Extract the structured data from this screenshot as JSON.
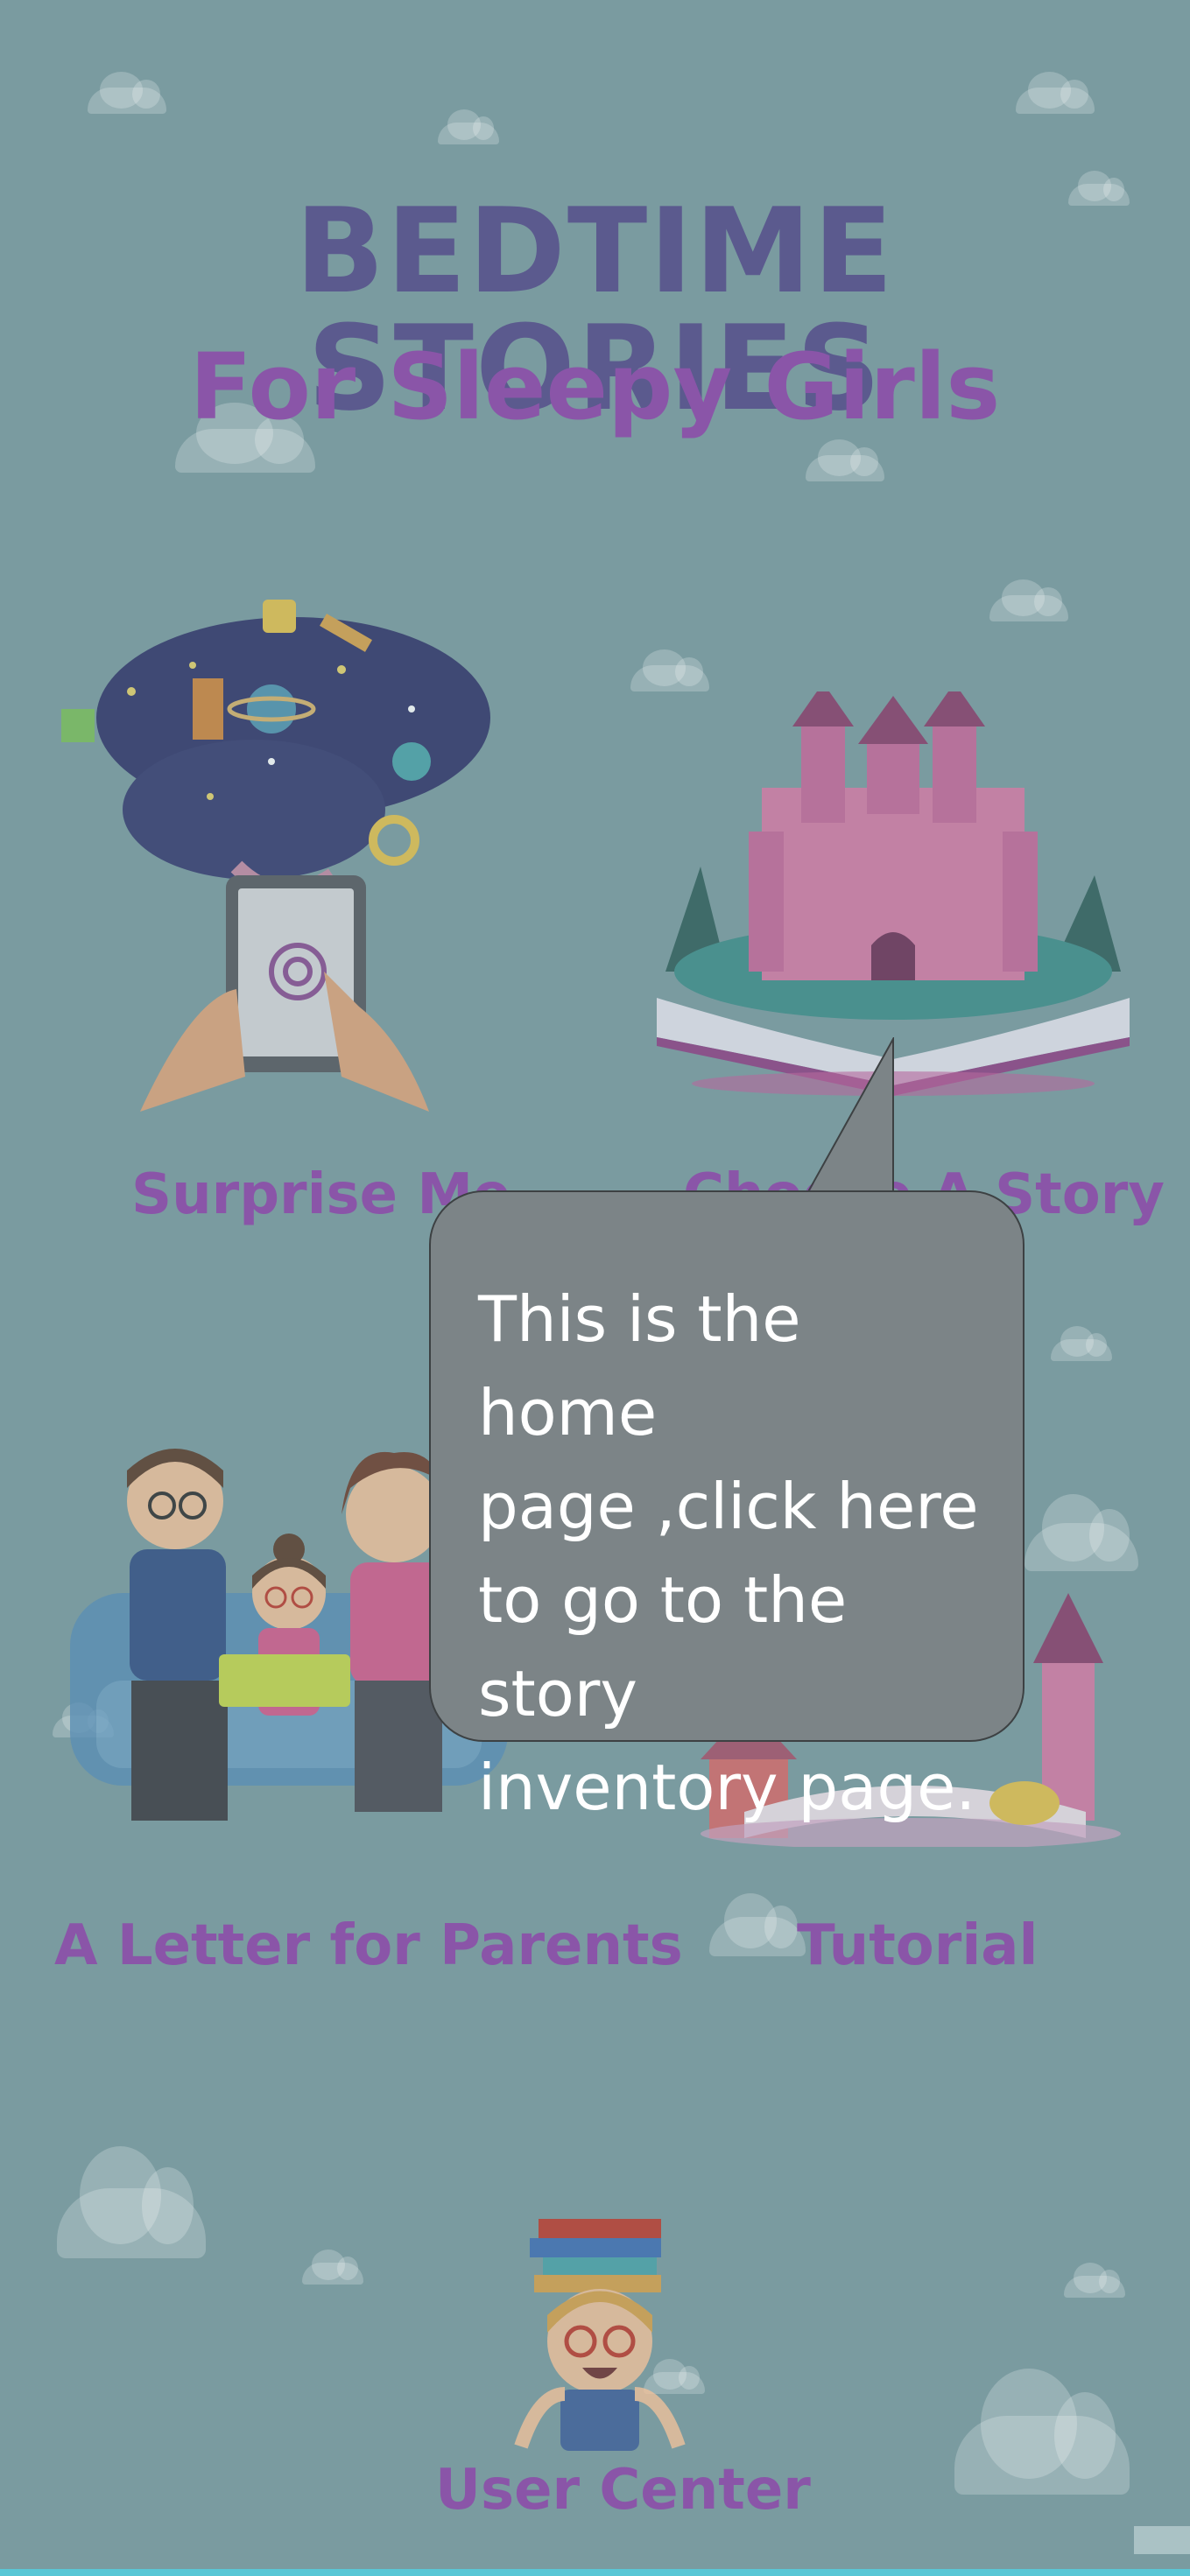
{
  "header": {
    "title": "BEDTIME STORIES",
    "subtitle": "For Sleepy Girls"
  },
  "menu": {
    "surprise_me": "Surprise Me",
    "choose_story": "Choose A Story",
    "letter_for_parents": "A Letter for Parents",
    "tutorial": "Tutorial",
    "user_center": "User Center"
  },
  "tooltip": {
    "line1": "This is the home",
    "line2": "page ,click here",
    "line3": "to go to the story",
    "line4": "inventory page."
  },
  "colors": {
    "background": "#7a9ba0",
    "title": "#5b5a8e",
    "accent_purple": "#8a55a8",
    "tooltip_bg": "#7c8487",
    "bottom_bar": "#59c7d6"
  }
}
